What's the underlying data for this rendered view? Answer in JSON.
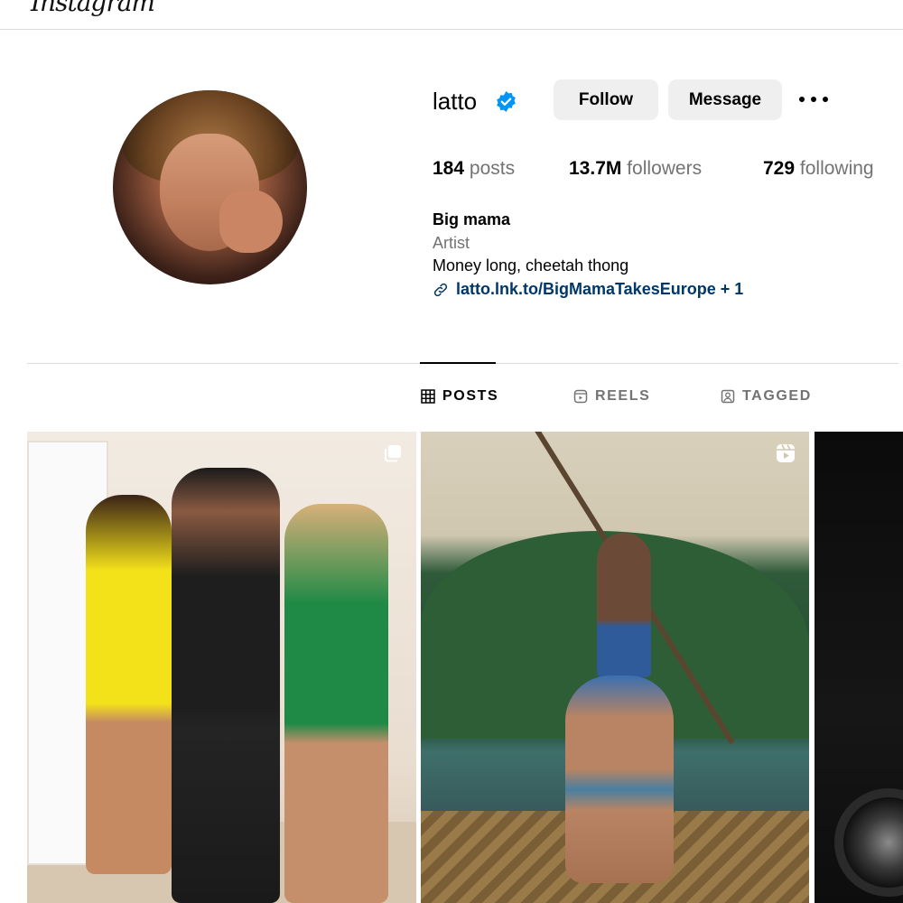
{
  "app": {
    "logo_text": "Instagram"
  },
  "profile": {
    "username": "latto",
    "verified": true,
    "buttons": {
      "follow": "Follow",
      "message": "Message"
    },
    "stats": {
      "posts_count": "184",
      "posts_label": "posts",
      "followers_count": "13.7M",
      "followers_label": "followers",
      "following_count": "729",
      "following_label": "following"
    },
    "bio": {
      "name": "Big mama",
      "category": "Artist",
      "text": "Money long, cheetah thong",
      "link": "latto.lnk.to/BigMamaTakesEurope + 1"
    }
  },
  "tabs": [
    {
      "label": "POSTS",
      "icon": "grid-icon",
      "active": true
    },
    {
      "label": "REELS",
      "icon": "reels-icon",
      "active": false
    },
    {
      "label": "TAGGED",
      "icon": "tagged-icon",
      "active": false
    }
  ],
  "posts": [
    {
      "type": "carousel",
      "icon": "carousel-icon"
    },
    {
      "type": "reel",
      "icon": "reel-icon"
    },
    {
      "type": "photo"
    }
  ],
  "colors": {
    "verified": "#0095f6",
    "button_bg": "#efefef",
    "link": "#00376b",
    "muted_text": "#737373",
    "divider": "#dbdbdb"
  }
}
